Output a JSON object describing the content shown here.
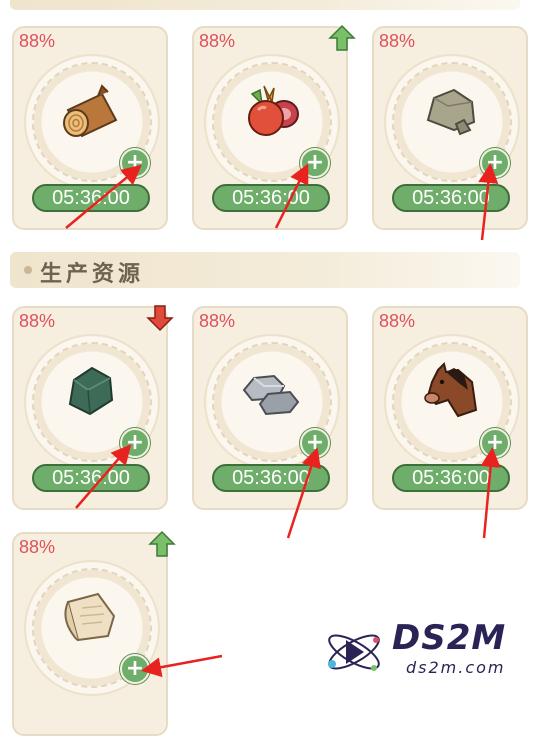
{
  "sections": [
    {
      "title": "生产资源"
    }
  ],
  "cards": [
    {
      "name": "wood-log",
      "percent": "88%",
      "timer": "05:36:00",
      "trend": "none"
    },
    {
      "name": "fruit-meat",
      "percent": "88%",
      "timer": "05:36:00",
      "trend": "up"
    },
    {
      "name": "stone",
      "percent": "88%",
      "timer": "05:36:00",
      "trend": "none"
    },
    {
      "name": "green-ore",
      "percent": "88%",
      "timer": "05:36:00",
      "trend": "down"
    },
    {
      "name": "grey-rock",
      "percent": "88%",
      "timer": "05:36:00",
      "trend": "none"
    },
    {
      "name": "horse",
      "percent": "88%",
      "timer": "05:36:00",
      "trend": "none"
    },
    {
      "name": "parchment",
      "percent": "88%",
      "timer": "05:36:00",
      "trend": "up"
    }
  ],
  "plus_symbol": "+",
  "watermark": {
    "brand": "DS2M",
    "url": "ds2m.com"
  },
  "colors": {
    "percent": "#e0505a",
    "timer_bg": "#6fae6a",
    "arrow_up": "#7ac06a",
    "arrow_down": "#e04a3c",
    "annotation": "#e8231f"
  }
}
